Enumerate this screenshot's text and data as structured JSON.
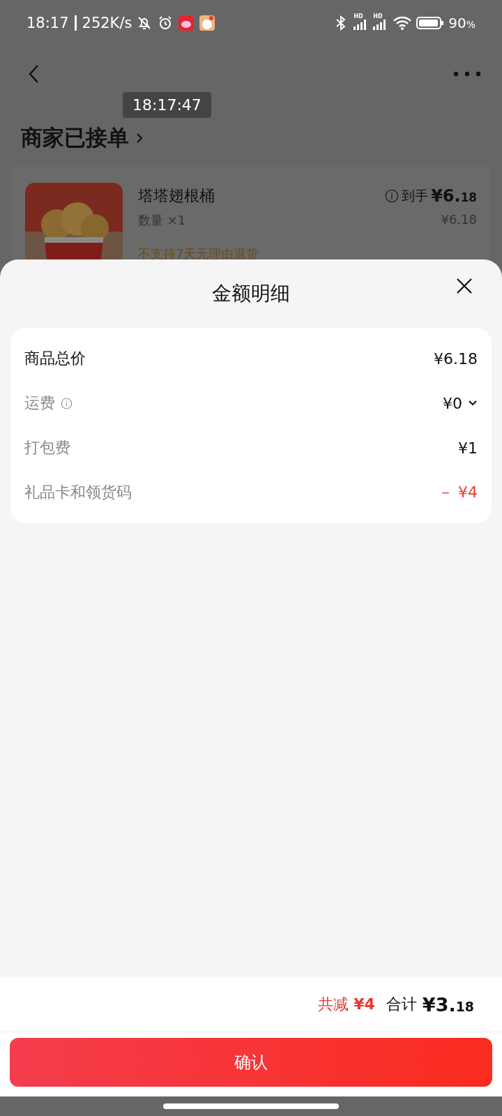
{
  "status_bar": {
    "time": "18:17",
    "speed": "252K/s",
    "signals": [
      {
        "label": "HD"
      },
      {
        "label": "HD"
      }
    ],
    "battery": "90",
    "battery_unit": "%"
  },
  "order_page": {
    "time_tooltip": "18:17:47",
    "title": "商家已接单",
    "product": {
      "name": "塔塔翅根桶",
      "quantity": "数量 ×1",
      "price_label": "到手",
      "price": "¥6.18",
      "original_price": "¥6.18",
      "notice": "不支持7天无理由退货"
    }
  },
  "sheet": {
    "title": "金额明细",
    "rows": [
      {
        "kind": "subtotal",
        "label": "商品总价",
        "value": "¥6.18",
        "info": false,
        "expandable": false
      },
      {
        "kind": "fee",
        "label": "运费",
        "value": "¥0",
        "info": true,
        "expandable": true
      },
      {
        "kind": "fee",
        "label": "打包费",
        "value": "¥1",
        "info": false,
        "expandable": false
      },
      {
        "kind": "discount",
        "label": "礼品卡和领货码",
        "value": "－ ¥4",
        "info": false,
        "expandable": false
      }
    ],
    "footer": {
      "saving_label": "共减",
      "saving": "¥4",
      "total_label": "合计",
      "total": "¥3.18"
    },
    "confirm_button": "确认"
  }
}
